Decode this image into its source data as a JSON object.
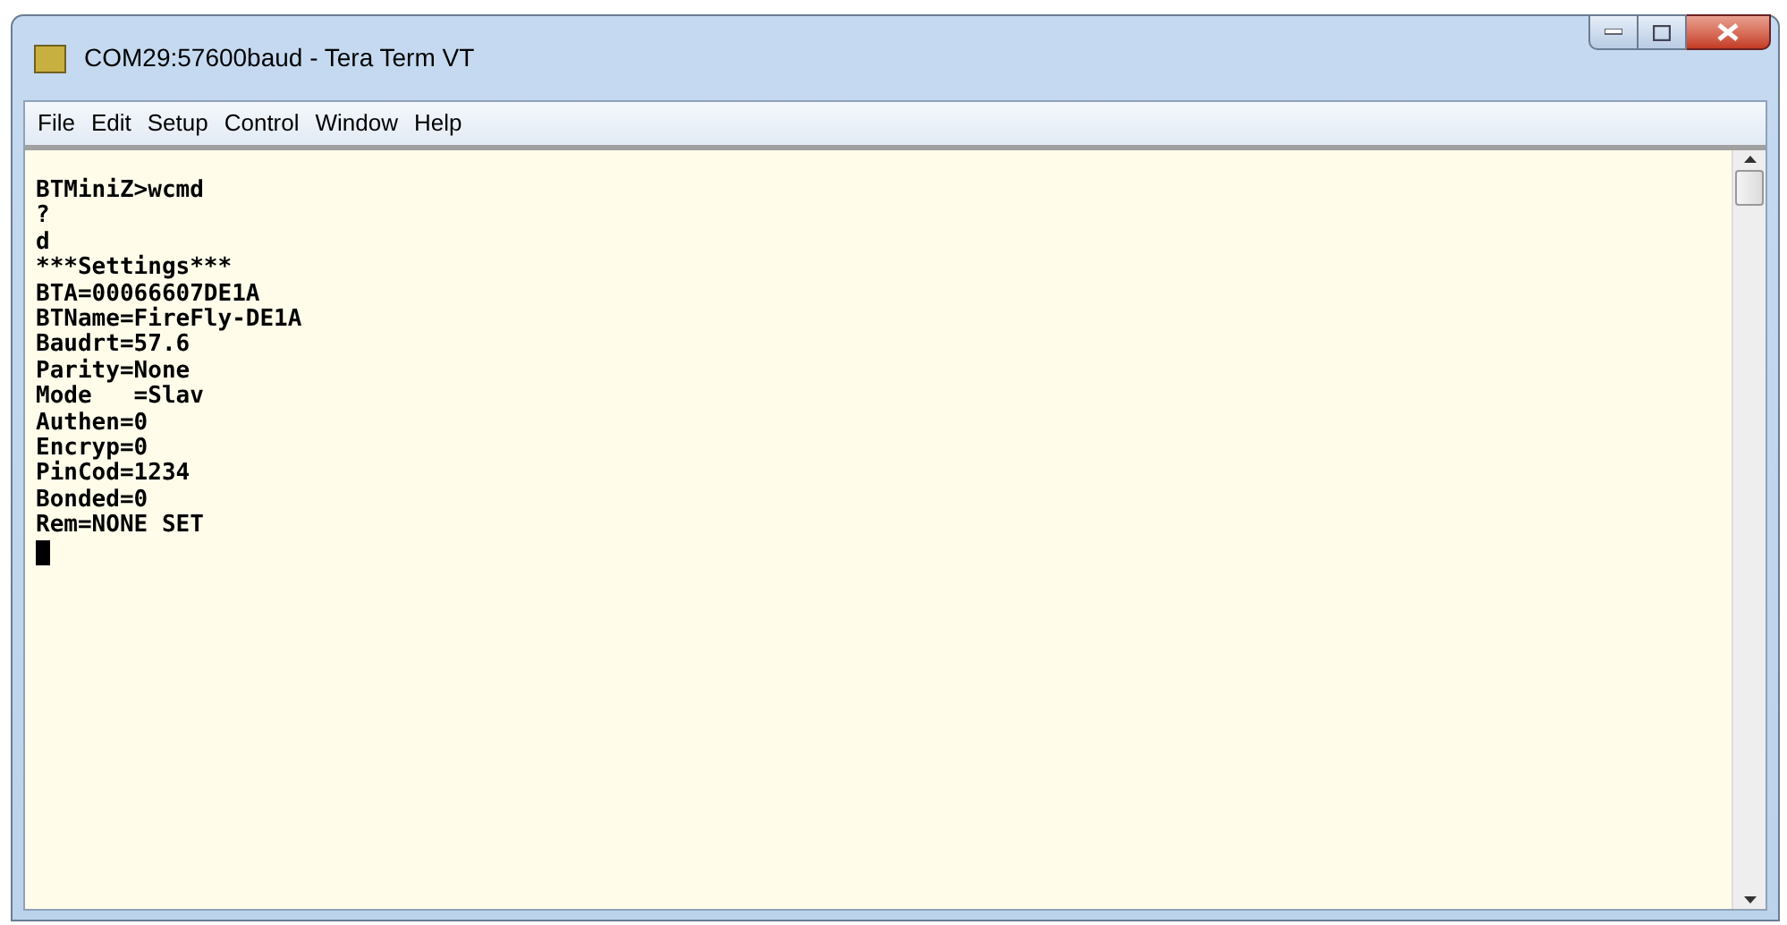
{
  "window": {
    "title": "COM29:57600baud - Tera Term VT"
  },
  "menu": [
    "File",
    "Edit",
    "Setup",
    "Control",
    "Window",
    "Help"
  ],
  "terminal": {
    "lines": [
      "BTMiniZ>wcmd",
      "?",
      "d",
      "***Settings***",
      "BTA=00066607DE1A",
      "BTName=FireFly-DE1A",
      "Baudrt=57.6",
      "Parity=None",
      "Mode   =Slav",
      "Authen=0",
      "Encryp=0",
      "PinCod=1234",
      "Bonded=0",
      "Rem=NONE SET"
    ]
  }
}
